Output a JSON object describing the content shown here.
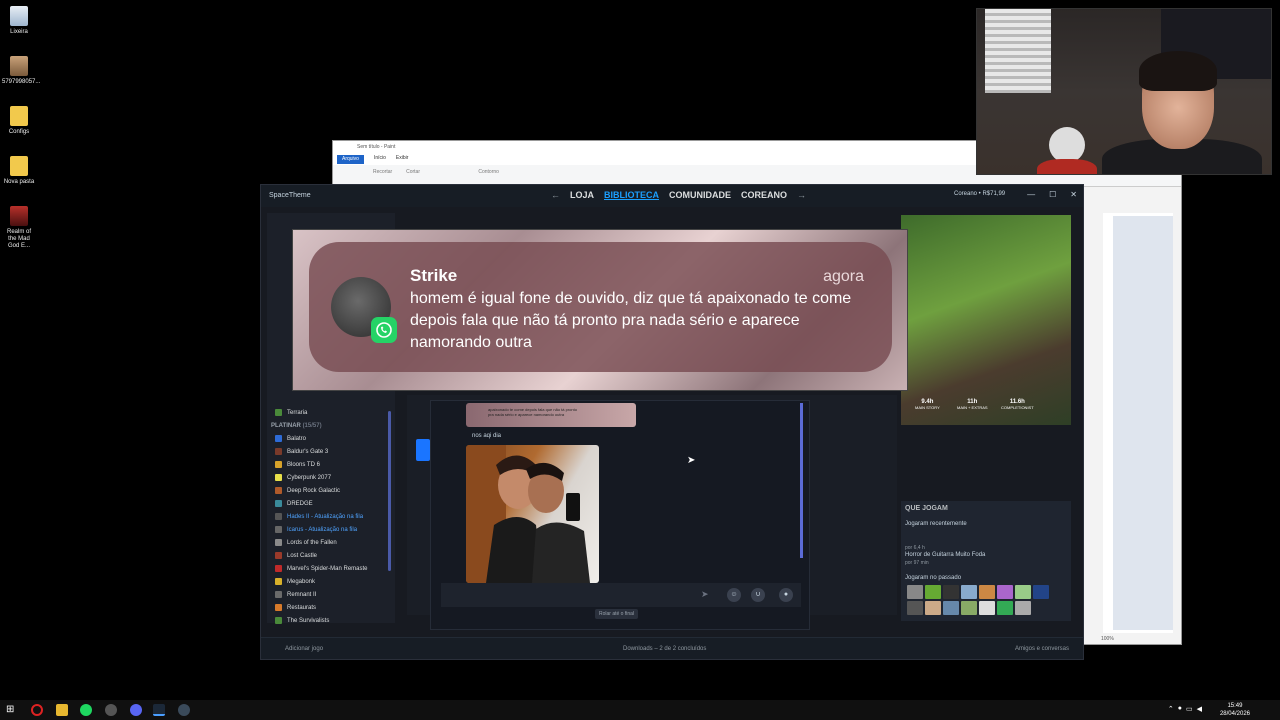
{
  "desktop": {
    "icons": [
      {
        "label": "Lixeira"
      },
      {
        "label": "5797998057..."
      },
      {
        "label": "Configs"
      },
      {
        "label": "Nova pasta"
      },
      {
        "label": "Realm of the Mad God E..."
      }
    ]
  },
  "paint": {
    "title": "Sem título - Paint",
    "menu": [
      "Arquivo",
      "Início",
      "Exibir"
    ],
    "ribbon": [
      "Recortar",
      "Cortar",
      "Contorno"
    ],
    "zoom": "100%"
  },
  "steam": {
    "brand": "SpaceTheme",
    "nav": [
      "LOJA",
      "BIBLIOTECA",
      "COMUNIDADE",
      "COREANO"
    ],
    "account": "Coreano • R$71,99",
    "sidebar": {
      "top_items": [
        "Terraria"
      ],
      "section": "PLATINAR",
      "section_count": "(15/57)",
      "items": [
        {
          "label": "Balatro",
          "color": "#2e6bd6",
          "update": false
        },
        {
          "label": "Baldur's Gate 3",
          "color": "#7a3a2a",
          "update": false
        },
        {
          "label": "Bloons TD 6",
          "color": "#d8a22a",
          "update": false
        },
        {
          "label": "Cyberpunk 2077",
          "color": "#e8e04a",
          "update": false
        },
        {
          "label": "Deep Rock Galactic",
          "color": "#b05a2a",
          "update": false
        },
        {
          "label": "DREDGE",
          "color": "#3a8a9a",
          "update": false
        },
        {
          "label": "Hades II - Atualização na fila",
          "color": "#555",
          "update": true
        },
        {
          "label": "Icarus - Atualização na fila",
          "color": "#666",
          "update": true
        },
        {
          "label": "Lords of the Fallen",
          "color": "#8a8a8a",
          "update": false
        },
        {
          "label": "Lost Castle",
          "color": "#9a3a2a",
          "update": false
        },
        {
          "label": "Marvel's Spider-Man Remaste",
          "color": "#c02a2a",
          "update": false
        },
        {
          "label": "Megabonk",
          "color": "#d8b02a",
          "update": false
        },
        {
          "label": "Remnant II",
          "color": "#6a6a6a",
          "update": false
        },
        {
          "label": "Restaurats",
          "color": "#d87a2a",
          "update": false
        },
        {
          "label": "The Survivalists",
          "color": "#4a8a3a",
          "update": false
        }
      ]
    },
    "stats": [
      {
        "value": "9.4h",
        "label": "MAIN STORY"
      },
      {
        "value": "11h",
        "label": "MAIN + EXTRAS"
      },
      {
        "value": "11.6h",
        "label": "COMPLETIONIST"
      }
    ],
    "friends": {
      "header": "QUE JOGAM",
      "recent_label": "Jogaram recentemente",
      "recent_sub": "por 6,4 h",
      "game_line": "Horror de Guitarra Muito Foda",
      "game_sub": "por 97 min",
      "past_label": "Jogaram no passado"
    },
    "bottom": {
      "add_game": "Adicionar jogo",
      "downloads": "Downloads – 2 de 2 concluídos",
      "friends_chat": "Amigos e conversas"
    }
  },
  "chat": {
    "quoted_line1": "apaixonado te come depois fala que não tá pronto",
    "quoted_line2": "pra nada sério e aparece namorando outra",
    "message": "nos aqi dia",
    "scroll_end": "Rolar até o final"
  },
  "notification": {
    "sender": "Strike",
    "time": "agora",
    "message": "homem é igual fone de ouvido, diz que tá apaixonado te come depois fala que não tá pronto pra nada sério e aparece namorando outra"
  },
  "taskbar": {
    "time": "15:49",
    "date": "28/04/2026"
  }
}
